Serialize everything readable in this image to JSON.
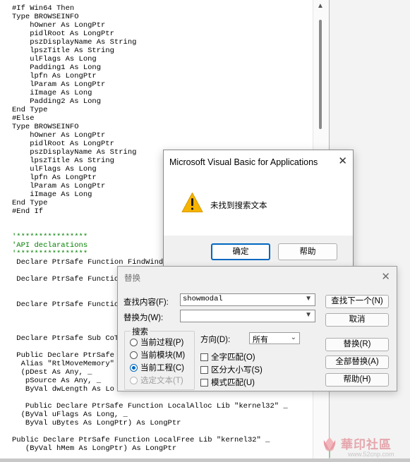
{
  "editor": {
    "lines": [
      {
        "text": "#If Win64 Then",
        "comment": false
      },
      {
        "text": "Type BROWSEINFO",
        "comment": false
      },
      {
        "text": "    hOwner As LongPtr",
        "comment": false
      },
      {
        "text": "    pidlRoot As LongPtr",
        "comment": false
      },
      {
        "text": "    pszDisplayName As String",
        "comment": false
      },
      {
        "text": "    lpszTitle As String",
        "comment": false
      },
      {
        "text": "    ulFlags As Long",
        "comment": false
      },
      {
        "text": "    Padding1 As Long",
        "comment": false
      },
      {
        "text": "    lpfn As LongPtr",
        "comment": false
      },
      {
        "text": "    lParam As LongPtr",
        "comment": false
      },
      {
        "text": "    iImage As Long",
        "comment": false
      },
      {
        "text": "    Padding2 As Long",
        "comment": false
      },
      {
        "text": "End Type",
        "comment": false
      },
      {
        "text": "#Else",
        "comment": false
      },
      {
        "text": "Type BROWSEINFO",
        "comment": false
      },
      {
        "text": "    hOwner As LongPtr",
        "comment": false
      },
      {
        "text": "    pidlRoot As LongPtr",
        "comment": false
      },
      {
        "text": "    pszDisplayName As String",
        "comment": false
      },
      {
        "text": "    lpszTitle As String",
        "comment": false
      },
      {
        "text": "    ulFlags As Long",
        "comment": false
      },
      {
        "text": "    lpfn As LongPtr",
        "comment": false
      },
      {
        "text": "    lParam As LongPtr",
        "comment": false
      },
      {
        "text": "    iImage As Long",
        "comment": false
      },
      {
        "text": "End Type",
        "comment": false
      },
      {
        "text": "#End If",
        "comment": false
      },
      {
        "text": "",
        "comment": false
      },
      {
        "text": "",
        "comment": false
      },
      {
        "text": "'****************",
        "comment": true
      },
      {
        "text": "'API declarations",
        "comment": true
      },
      {
        "text": "'****************",
        "comment": true
      },
      {
        "text": " Declare PtrSafe Function FindWindow",
        "comment": false
      },
      {
        "text": "",
        "comment": false
      },
      {
        "text": " Declare PtrSafe Function",
        "comment": false
      },
      {
        "text": "",
        "comment": false
      },
      {
        "text": "",
        "comment": false
      },
      {
        "text": " Declare PtrSafe Function",
        "comment": false
      },
      {
        "text": "",
        "comment": false
      },
      {
        "text": "",
        "comment": false
      },
      {
        "text": "",
        "comment": false
      },
      {
        "text": " Declare PtrSafe Sub CoTe",
        "comment": false
      },
      {
        "text": "",
        "comment": false
      },
      {
        "text": " Public Declare PtrSafe S",
        "comment": false
      },
      {
        "text": "  Alias \"RtlMoveMemory\"",
        "comment": false
      },
      {
        "text": "  (pDest As Any, _",
        "comment": false
      },
      {
        "text": "   pSource As Any, _",
        "comment": false
      },
      {
        "text": "   ByVal dwLength As Lo",
        "comment": false
      },
      {
        "text": "",
        "comment": false
      },
      {
        "text": "   Public Declare PtrSafe Function LocalAlloc Lib \"kernel32\" _",
        "comment": false
      },
      {
        "text": "  (ByVal uFlags As Long, _",
        "comment": false
      },
      {
        "text": "   ByVal uBytes As LongPtr) As LongPtr",
        "comment": false
      },
      {
        "text": "",
        "comment": false
      },
      {
        "text": "Public Declare PtrSafe Function LocalFree Lib \"kernel32\" _",
        "comment": false
      },
      {
        "text": "   (ByVal hMem As LongPtr) As LongPtr",
        "comment": false
      }
    ]
  },
  "msgbox": {
    "title": "Microsoft Visual Basic for Applications",
    "close": "✕",
    "icon": "warning-icon",
    "message": "未找到搜索文本",
    "ok_label": "确定",
    "help_label": "帮助"
  },
  "replace_dialog": {
    "title": "替换",
    "close": "✕",
    "find_label": "查找内容(F):",
    "find_value": "showmodal",
    "replace_label": "替换为(W):",
    "replace_value": "",
    "search_group": "搜索",
    "scope_options": [
      {
        "label": "当前过程(P)",
        "checked": false,
        "disabled": false
      },
      {
        "label": "当前模块(M)",
        "checked": false,
        "disabled": false
      },
      {
        "label": "当前工程(C)",
        "checked": true,
        "disabled": false
      },
      {
        "label": "选定文本(T)",
        "checked": false,
        "disabled": true
      }
    ],
    "direction_label": "方向(D):",
    "direction_value": "所有",
    "options": [
      {
        "label": "全字匹配(O)",
        "checked": false
      },
      {
        "label": "区分大小写(S)",
        "checked": false
      },
      {
        "label": "模式匹配(U)",
        "checked": false
      }
    ],
    "buttons": {
      "find_next": "查找下一个(N)",
      "cancel": "取消",
      "replace": "替换(R)",
      "replace_all": "全部替换(A)",
      "help": "帮助(H)"
    }
  },
  "watermark": {
    "text": "華印社區",
    "url": "www.52cnp.com"
  },
  "colors": {
    "accent": "#0067c0",
    "comment": "#008000",
    "warning": "#f4b400"
  }
}
